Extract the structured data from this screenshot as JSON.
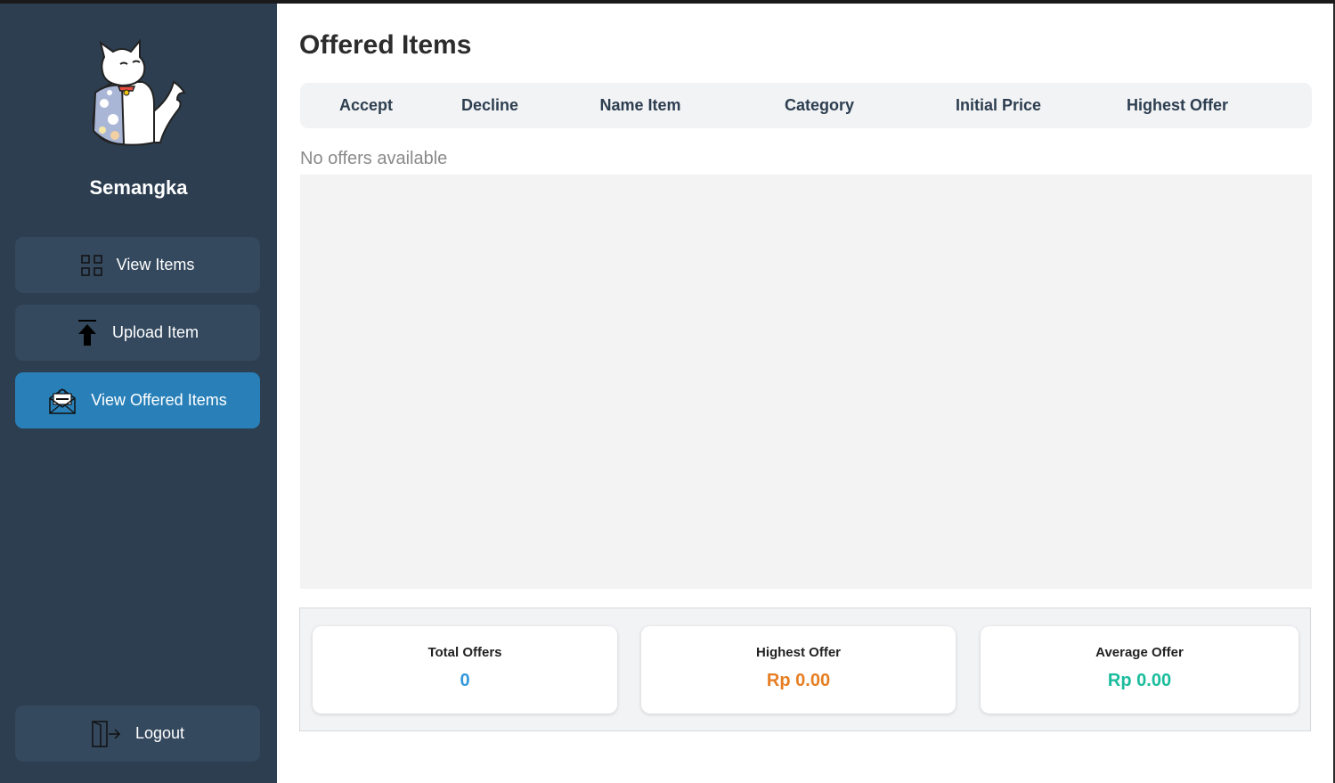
{
  "user": {
    "name": "Semangka",
    "avatar_icon": "cat-character-avatar"
  },
  "sidebar": {
    "items": [
      {
        "label": "View Items",
        "icon": "grid-icon"
      },
      {
        "label": "Upload Item",
        "icon": "upload-arrow-icon"
      },
      {
        "label": "View Offered Items",
        "icon": "offer-envelope-icon",
        "active": true
      }
    ],
    "logout": {
      "label": "Logout",
      "icon": "logout-door-icon"
    }
  },
  "main": {
    "title": "Offered Items",
    "columns": [
      "Accept",
      "Decline",
      "Name Item",
      "Category",
      "Initial Price",
      "Highest Offer"
    ],
    "empty_message": "No offers available",
    "stats": {
      "total": {
        "label": "Total Offers",
        "value": "0",
        "color": "#3498db"
      },
      "highest": {
        "label": "Highest Offer",
        "value": "Rp 0.00",
        "color": "#e67e22"
      },
      "average": {
        "label": "Average Offer",
        "value": "Rp 0.00",
        "color": "#1abc9c"
      }
    }
  },
  "colors": {
    "sidebar_bg": "#2c3e50",
    "nav_button_bg": "#34495e",
    "active_bg": "#2980b9"
  }
}
